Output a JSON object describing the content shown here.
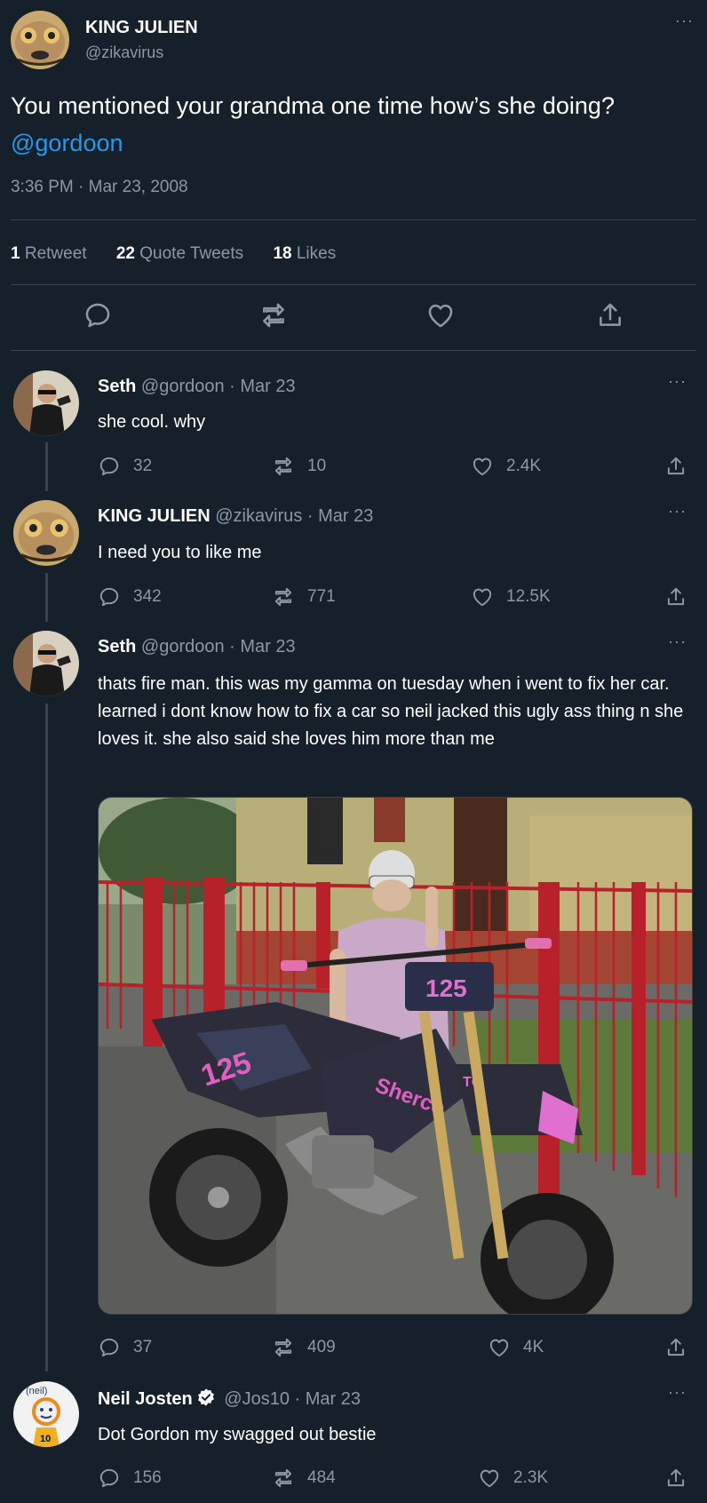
{
  "main_tweet": {
    "display_name": "KING JULIEN",
    "handle": "@zikavirus",
    "text_before_mention": "You mentioned your grandma one time how’s she doing? ",
    "mention": "@gordoon",
    "timestamp": "3:36 PM · Mar 23, 2008",
    "retweets_count": "1",
    "retweets_label": "Retweet",
    "quotes_count": "22",
    "quotes_label": "Quote Tweets",
    "likes_count": "18",
    "likes_label": "Likes",
    "more_label": "···"
  },
  "replies": [
    {
      "display_name": "Seth",
      "handle_date": "@gordoon · Mar 23",
      "text": "she cool. why",
      "replies": "32",
      "retweets": "10",
      "likes": "2.4K"
    },
    {
      "display_name": "KING JULIEN",
      "handle_date": "@zikavirus · Mar 23",
      "text": "I need you to like me",
      "replies": "342",
      "retweets": "771",
      "likes": "12.5K"
    },
    {
      "display_name": "Seth",
      "handle_date": "@gordoon · Mar 23",
      "text": "thats fire man. this was my gamma on tuesday when i went to fix her car. learned i dont know how to fix a car so neil jacked this ugly ass thing n she loves it. she also said she loves him more than me",
      "replies": "37",
      "retweets": "409",
      "likes": "4K",
      "media": {
        "bike_number": "125",
        "bike_brand": "Sherco",
        "bike_model": "TC"
      }
    },
    {
      "display_name": "Neil Josten",
      "handle_date": "@Jos10 · Mar 23",
      "text": "Dot Gordon my swagged out bestie",
      "replies": "156",
      "retweets": "484",
      "likes": "2.3K",
      "avatar_text": "(neil)",
      "avatar_number": "10"
    }
  ],
  "colors": {
    "background": "#15202b",
    "text": "#ffffff",
    "muted": "#8b98a5",
    "link": "#1d9bf0",
    "divider": "#38444d"
  },
  "icons": [
    "reply-icon",
    "retweet-icon",
    "like-icon",
    "share-icon",
    "more-icon",
    "verified-icon"
  ]
}
